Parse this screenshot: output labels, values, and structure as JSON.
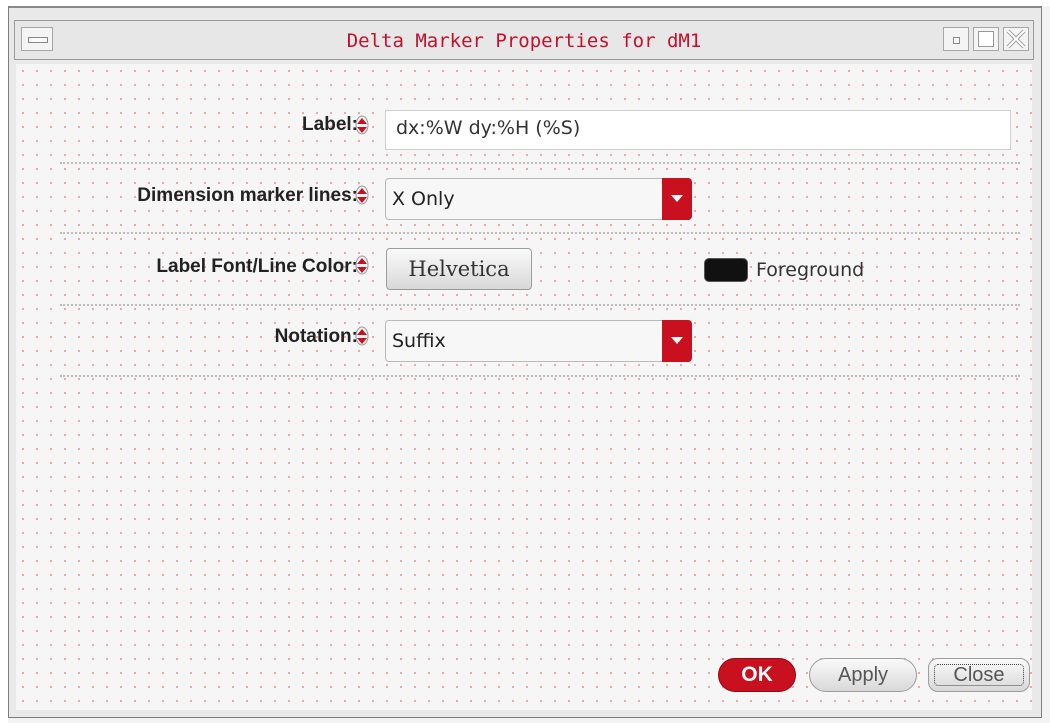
{
  "window": {
    "title": "Delta Marker Properties for dM1"
  },
  "form": {
    "label": {
      "label": "Label:",
      "value": "dx:%W dy:%H (%S)"
    },
    "dimension_marker_lines": {
      "label": "Dimension marker lines:",
      "selected": "X Only"
    },
    "label_font_line_color": {
      "label": "Label Font/Line Color:",
      "font_button": "Helvetica",
      "color_name": "Foreground",
      "color_swatch": "#111111"
    },
    "notation": {
      "label": "Notation:",
      "selected": "Suffix"
    }
  },
  "buttons": {
    "ok": "OK",
    "apply": "Apply",
    "close": "Close"
  },
  "colors": {
    "accent": "#c8101e",
    "title_text": "#c4102c",
    "dots": "#ee9a9a"
  },
  "icons": {
    "window_menu": "window-menu-icon",
    "minimize": "minimize-icon",
    "maximize": "maximize-icon",
    "close": "close-x-icon",
    "spin": "spin-arrow-icon"
  }
}
